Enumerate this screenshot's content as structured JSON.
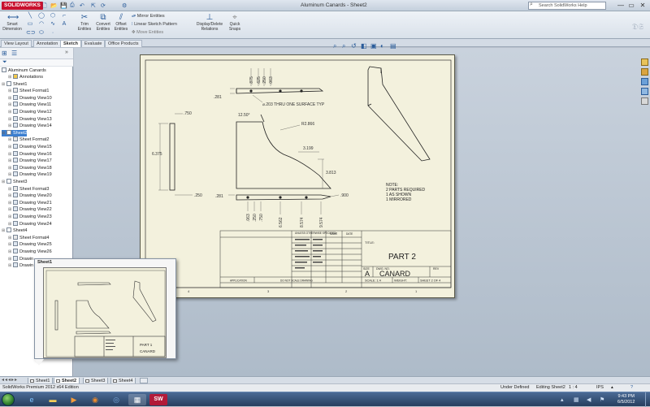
{
  "app": {
    "logo": "SOLIDWORKS",
    "title": "Aluminum Canards - Sheet2",
    "search_placeholder": "Search SolidWorks Help",
    "window_controls": [
      "—",
      "▭",
      "✕"
    ]
  },
  "ribbon": {
    "smart_dimension": [
      "Smart",
      "Dimension"
    ],
    "trim_entities": [
      "Trim",
      "Entities"
    ],
    "convert_entities": [
      "Convert",
      "Entities"
    ],
    "offset_entities": [
      "Offset",
      "Entities"
    ],
    "mirror_entities": "Mirror Entities",
    "linear_sketch_pattern": "Linear Sketch Pattern",
    "move_entities": "Move Entities",
    "display_delete_relations": [
      "Display/Delete",
      "Relations"
    ],
    "quick_snaps": [
      "Quick",
      "Snaps"
    ]
  },
  "tabs": [
    "View Layout",
    "Annotation",
    "Sketch",
    "Evaluate",
    "Office Products"
  ],
  "active_tab": "Sketch",
  "feature_tree": {
    "root": "Aluminum Canards",
    "annotations": "Annotations",
    "sheets": [
      {
        "name": "Sheet1",
        "format": "Sheet Format1",
        "views": [
          "Drawing View10",
          "Drawing View11",
          "Drawing View12",
          "Drawing View13",
          "Drawing View14"
        ]
      },
      {
        "name": "Sheet2",
        "format": "Sheet Format2",
        "views": [
          "Drawing View15",
          "Drawing View16",
          "Drawing View17",
          "Drawing View18",
          "Drawing View19"
        ]
      },
      {
        "name": "Sheet3",
        "format": "Sheet Format3",
        "views": [
          "Drawing View20",
          "Drawing View21",
          "Drawing View22",
          "Drawing View23",
          "Drawing View24"
        ]
      },
      {
        "name": "Sheet4",
        "format": "Sheet Format4",
        "views": [
          "Drawing View25",
          "Drawing View26",
          "Drawin",
          "Drawin"
        ]
      }
    ]
  },
  "drawing": {
    "dims_top": [
      ".875",
      ".625",
      ".250",
      ".063"
    ],
    "dim_281": ".281",
    "hole_callout": "⌀.203 THRU ONE SURFACE TYP",
    "angle": "12.50°",
    "radius": "R2.866",
    "dim_3199": "3.199",
    "dim_3813": "3.813",
    "dim_750": ".750",
    "dim_6375": "6.375",
    "dim_250": ".250",
    "dim_900": ".900",
    "dims_bottom": [
      ".063",
      ".250",
      ".750",
      "6.562",
      "8.574",
      "9.574"
    ],
    "notes": [
      "NOTE:",
      "2 PARTS REQUIRED",
      "1 AS SHOWN",
      "1 MIRRORED"
    ],
    "title_block": {
      "part": "PART 2",
      "name": "CANARD",
      "size": "A",
      "title_label": "TITLE:",
      "size_label": "SIZE",
      "dwg_label": "DWG. NO.",
      "rev_label": "REV",
      "scale": "SCALE: 1:4",
      "weight": "WEIGHT:",
      "sheet": "SHEET 2 OF 4",
      "unless": "UNLESS OTHERWISE SPECIFIED:",
      "name_col": "NAME",
      "date_col": "DATE",
      "application": "APPLICATION",
      "do_not_scale": "DO NOT SCALE DRAWING"
    },
    "zones": [
      "4",
      "3",
      "2",
      "1"
    ]
  },
  "preview": {
    "title": "Sheet1",
    "part": "PART 1",
    "name": "CANARD"
  },
  "sheet_tabs": [
    "Sheet1",
    "Sheet2",
    "Sheet3",
    "Sheet4"
  ],
  "active_sheet": "Sheet2",
  "status": {
    "edition": "SolidWorks Premium 2012 x64 Edition",
    "state": "Under Defined",
    "editing": "Editing Sheet2",
    "scale": "1 : 4",
    "units": "IPS",
    "help": "?"
  },
  "clock": {
    "time": "9:43 PM",
    "date": "6/5/2012"
  }
}
